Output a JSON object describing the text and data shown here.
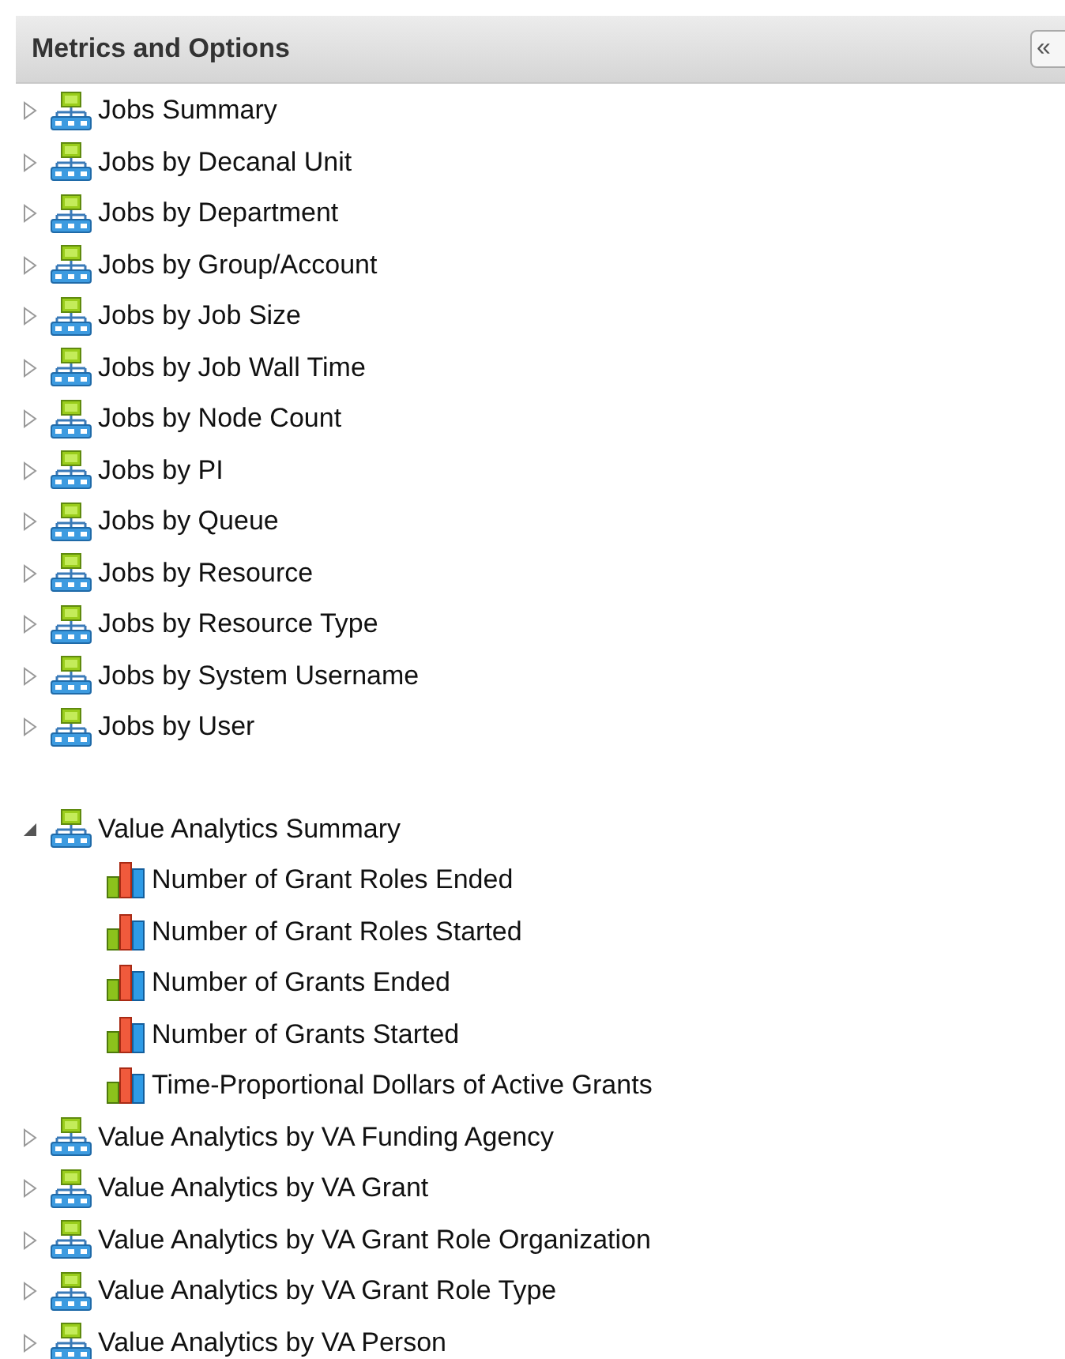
{
  "panel": {
    "title": "Metrics and Options",
    "collapse_button": "«"
  },
  "sections": [
    {
      "items": [
        {
          "label": "Jobs Summary",
          "kind": "group",
          "expanded": false
        },
        {
          "label": "Jobs by Decanal Unit",
          "kind": "group",
          "expanded": false
        },
        {
          "label": "Jobs by Department",
          "kind": "group",
          "expanded": false
        },
        {
          "label": "Jobs by Group/Account",
          "kind": "group",
          "expanded": false
        },
        {
          "label": "Jobs by Job Size",
          "kind": "group",
          "expanded": false
        },
        {
          "label": "Jobs by Job Wall Time",
          "kind": "group",
          "expanded": false
        },
        {
          "label": "Jobs by Node Count",
          "kind": "group",
          "expanded": false
        },
        {
          "label": "Jobs by PI",
          "kind": "group",
          "expanded": false
        },
        {
          "label": "Jobs by Queue",
          "kind": "group",
          "expanded": false
        },
        {
          "label": "Jobs by Resource",
          "kind": "group",
          "expanded": false
        },
        {
          "label": "Jobs by Resource Type",
          "kind": "group",
          "expanded": false
        },
        {
          "label": "Jobs by System Username",
          "kind": "group",
          "expanded": false
        },
        {
          "label": "Jobs by User",
          "kind": "group",
          "expanded": false
        }
      ]
    },
    {
      "items": [
        {
          "label": "Value Analytics Summary",
          "kind": "group",
          "expanded": true,
          "children": [
            {
              "label": "Number of Grant Roles Ended",
              "kind": "metric"
            },
            {
              "label": "Number of Grant Roles Started",
              "kind": "metric"
            },
            {
              "label": "Number of Grants Ended",
              "kind": "metric"
            },
            {
              "label": "Number of Grants Started",
              "kind": "metric"
            },
            {
              "label": "Time-Proportional Dollars of Active Grants",
              "kind": "metric"
            }
          ]
        },
        {
          "label": "Value Analytics by VA Funding Agency",
          "kind": "group",
          "expanded": false
        },
        {
          "label": "Value Analytics by VA Grant",
          "kind": "group",
          "expanded": false
        },
        {
          "label": "Value Analytics by VA Grant Role Organization",
          "kind": "group",
          "expanded": false
        },
        {
          "label": "Value Analytics by VA Grant Role Type",
          "kind": "group",
          "expanded": false
        },
        {
          "label": "Value Analytics by VA Person",
          "kind": "group",
          "expanded": false
        }
      ]
    }
  ]
}
